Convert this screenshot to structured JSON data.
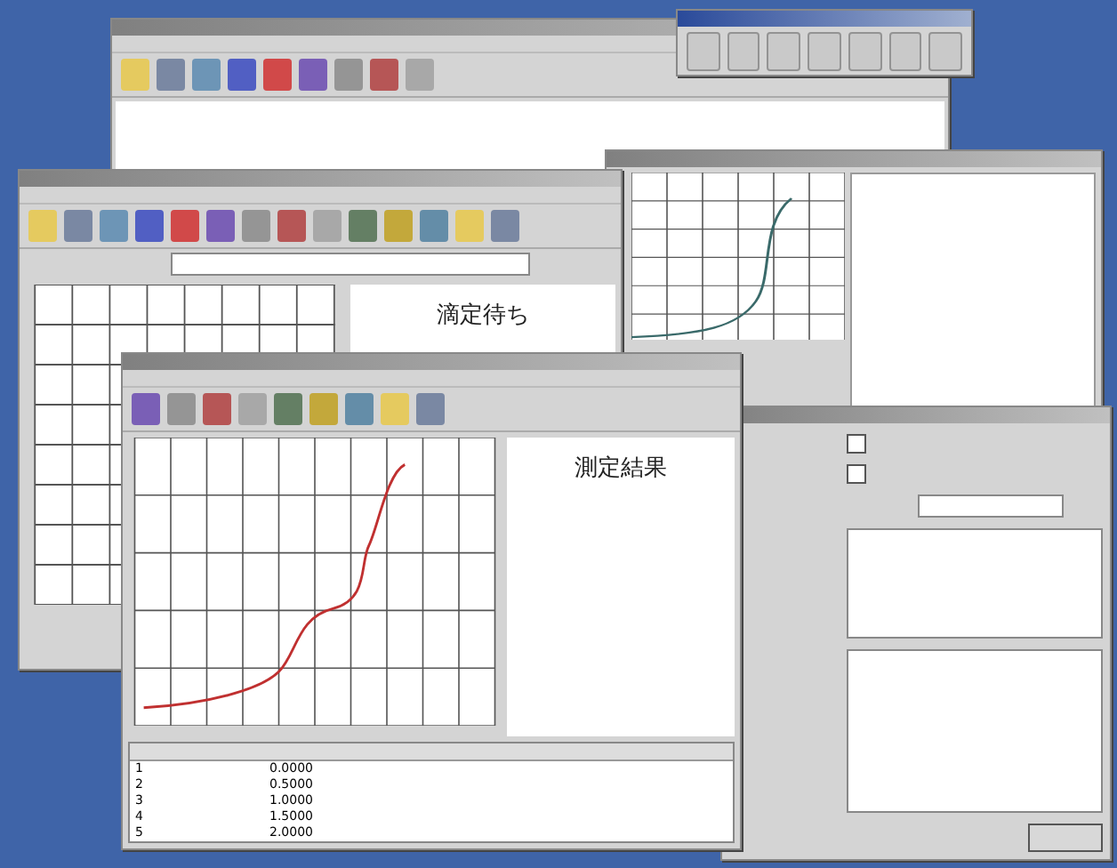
{
  "back_window": {
    "report_title": "滴定待ち"
  },
  "settings_window": {
    "options": [
      {
        "checked": false
      },
      {
        "checked": false
      }
    ]
  },
  "front_window": {
    "report_title": "測定結果",
    "rows": [
      {
        "no": "1",
        "volume": "0.0000"
      },
      {
        "no": "2",
        "volume": "0.5000"
      },
      {
        "no": "3",
        "volume": "1.0000"
      },
      {
        "no": "4",
        "volume": "1.5000"
      },
      {
        "no": "5",
        "volume": "2.0000"
      }
    ]
  }
}
